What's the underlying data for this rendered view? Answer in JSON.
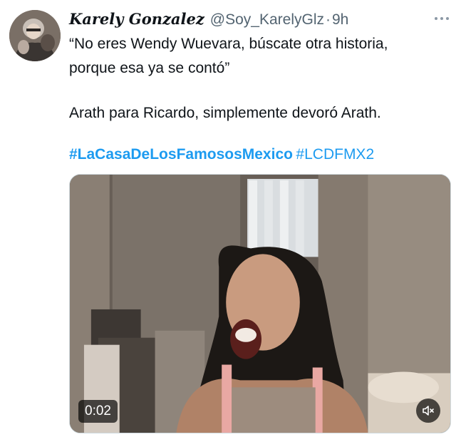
{
  "author": {
    "display_name": "Karely Gonzalez",
    "handle": "@Soy_KarelyGlz",
    "separator": "·",
    "time": "9h",
    "avatar_icon": "profile-avatar"
  },
  "more_icon": "more-dots-icon",
  "tweet": {
    "quote_line_1": "“No eres Wendy Wuevara, búscate otra historia,",
    "quote_line_2": "porque esa ya se contó”",
    "comment": "Arath para Ricardo, simplemente devoró Arath.",
    "hashtags": [
      "#LaCasaDeLosFamososMexico",
      "#LCDFMX2"
    ]
  },
  "media": {
    "type": "video",
    "duration": "0:02",
    "mute_icon": "speaker-muted-icon"
  },
  "colors": {
    "link": "#1d9bf0",
    "secondary_text": "#536471",
    "primary_text": "#0f1419"
  }
}
